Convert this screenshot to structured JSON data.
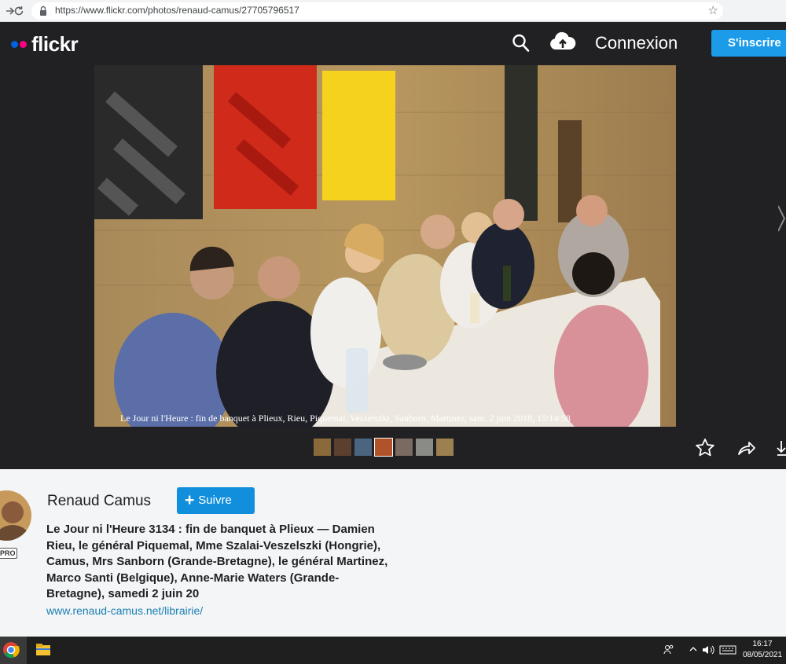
{
  "browser": {
    "url": "https://www.flickr.com/photos/renaud-camus/27705796517"
  },
  "header": {
    "logo_text": "flickr",
    "login_label": "Connexion",
    "signup_label": "S'inscrire"
  },
  "photo": {
    "caption": "Le Jour ni l'Heure : fin de banquet à Plieux, Rieu, Piquemal, Veszelszki, Sanborn, Martinez, sam. 2 juin 2018, 15:14:58",
    "thumbnail_count": 7
  },
  "info": {
    "author_name": "Renaud Camus",
    "pro_badge": "PRO",
    "follow_label": "Suivre",
    "title": "Le Jour ni l'Heure 3134 : fin de banquet à Plieux — Damien Rieu, le général Piquemal, Mme Szalai-Veszelszki (Hongrie), Camus, Mrs Sanborn (Grande-Bretagne), le général Martinez, Marco Santi (Belgique), Anne-Marie Waters (Grande-Bretagne), samedi 2 juin 20",
    "link": "www.renaud-camus.net/librairie/"
  },
  "taskbar": {
    "time": "16:17",
    "date": "08/05/2021"
  },
  "colors": {
    "flickr_blue": "#0063dc",
    "flickr_pink": "#ff0084",
    "signup_blue": "#1c9be9",
    "follow_blue": "#128fdc",
    "header_bg": "#212124"
  }
}
